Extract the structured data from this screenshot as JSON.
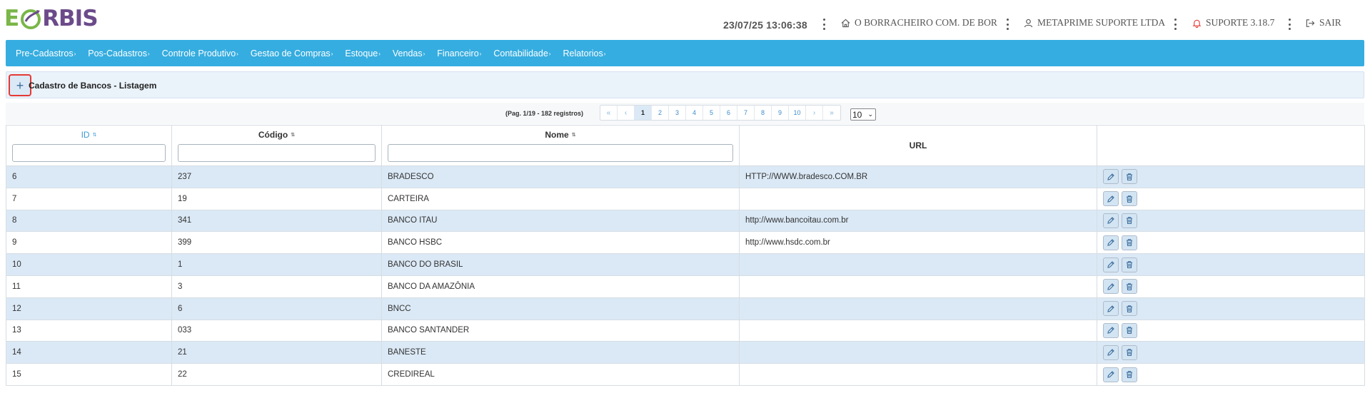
{
  "header": {
    "logo_e": "E",
    "logo_rest": "RBIS",
    "datetime": "23/07/25 13:06:38",
    "company": "O BORRACHEIRO COM. DE BOR",
    "user": "METAPRIME SUPORTE LTDA",
    "support": "SUPORTE 3.18.7",
    "logout": "SAIR",
    "accent": "#36ade0",
    "logo_green": "#7ab648",
    "logo_purple": "#6b4a8a"
  },
  "nav": {
    "items": [
      {
        "label": "Pre-Cadastros"
      },
      {
        "label": "Pos-Cadastros"
      },
      {
        "label": "Controle Produtivo"
      },
      {
        "label": "Gestao de Compras"
      },
      {
        "label": "Estoque"
      },
      {
        "label": "Vendas"
      },
      {
        "label": "Financeiro"
      },
      {
        "label": "Contabilidade"
      },
      {
        "label": "Relatorios"
      }
    ]
  },
  "page": {
    "add_icon": "plus-icon",
    "title": "Cadastro de Bancos - Listagem"
  },
  "pagination": {
    "info": "(Pag. 1/19 - 182 registros)",
    "first": "«",
    "prev": "‹",
    "next": "›",
    "last": "»",
    "pages": [
      "1",
      "2",
      "3",
      "4",
      "5",
      "6",
      "7",
      "8",
      "9",
      "10"
    ],
    "current_page": 1,
    "per_page": "10"
  },
  "table": {
    "columns": {
      "id": "ID",
      "codigo": "Código",
      "nome": "Nome",
      "url": "URL"
    },
    "rows": [
      {
        "id": "6",
        "codigo": "237",
        "nome": "BRADESCO",
        "url": "HTTP://WWW.bradesco.COM.BR"
      },
      {
        "id": "7",
        "codigo": "19",
        "nome": "CARTEIRA",
        "url": ""
      },
      {
        "id": "8",
        "codigo": "341",
        "nome": "BANCO ITAU",
        "url": "http://www.bancoitau.com.br"
      },
      {
        "id": "9",
        "codigo": "399",
        "nome": "BANCO HSBC",
        "url": "http://www.hsdc.com.br"
      },
      {
        "id": "10",
        "codigo": "1",
        "nome": "BANCO DO BRASIL",
        "url": ""
      },
      {
        "id": "11",
        "codigo": "3",
        "nome": "BANCO DA AMAZÔNIA",
        "url": ""
      },
      {
        "id": "12",
        "codigo": "6",
        "nome": "BNCC",
        "url": ""
      },
      {
        "id": "13",
        "codigo": "033",
        "nome": "BANCO SANTANDER",
        "url": ""
      },
      {
        "id": "14",
        "codigo": "21",
        "nome": "BANESTE",
        "url": ""
      },
      {
        "id": "15",
        "codigo": "22",
        "nome": "CREDIREAL",
        "url": ""
      }
    ]
  }
}
